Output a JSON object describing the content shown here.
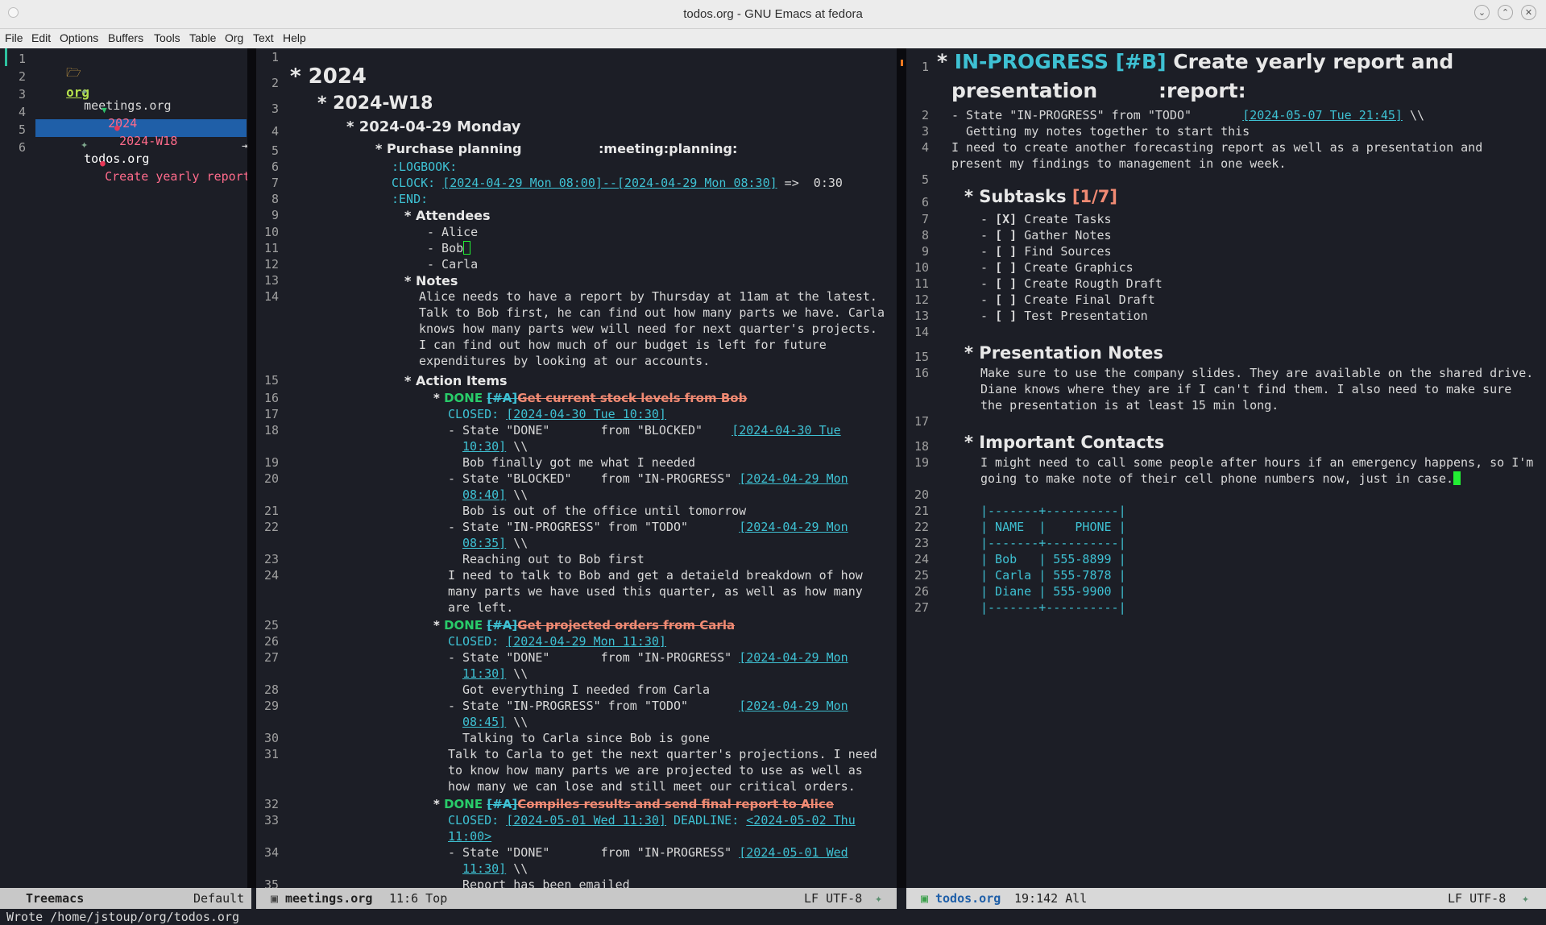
{
  "window": {
    "title": "todos.org - GNU Emacs at fedora",
    "buttons": [
      "minimize",
      "maximize",
      "close"
    ]
  },
  "menubar": [
    "File",
    "Edit",
    "Options",
    "Buffers",
    "Tools",
    "Table",
    "Org",
    "Text",
    "Help"
  ],
  "treemacs": {
    "items": [
      {
        "ln": "1",
        "label": "org",
        "icon": "folder-icon"
      },
      {
        "ln": "2",
        "label": "meetings.org",
        "icon": "org-unicorn-icon"
      },
      {
        "ln": "3",
        "label": "2024",
        "icon": "chevron-down-icon"
      },
      {
        "ln": "4",
        "label": "2024-W18",
        "icon": "bullet-icon"
      },
      {
        "ln": "5",
        "label": "todos.org",
        "icon": "org-unicorn-icon"
      },
      {
        "ln": "6",
        "label": "Create yearly report a",
        "icon": "bullet-icon"
      }
    ],
    "overflow_arrow": "⇥",
    "selection_color": "#1f5fa8"
  },
  "left": {
    "lines": {
      "l1": "1",
      "l2": "2",
      "l3": "3",
      "l4": "4",
      "l5": "5",
      "l6": "6",
      "l7": "7",
      "l8": "8",
      "l9": "9",
      "l10": "10",
      "l11": "11",
      "l12": "12",
      "l13": "13",
      "l14": "14",
      "l15": "15",
      "l16": "16",
      "l17": "17",
      "l18": "18",
      "l19": "19",
      "l20": "20",
      "l21": "21",
      "l22": "22",
      "l23": "23",
      "l24": "24",
      "l25": "25",
      "l26": "26",
      "l27": "27",
      "l28": "28",
      "l29": "29",
      "l30": "30",
      "l31": "31",
      "l32": "32",
      "l33": "33",
      "l34": "34",
      "l35": "35"
    },
    "h_2024": "2024",
    "h_w18": "2024-W18",
    "h_monday": "2024-04-29 Monday",
    "h_purchase": "Purchase planning",
    "h_purchase_tags": ":meeting:planning:",
    "logbook": ":LOGBOOK:",
    "clock_kw": "CLOCK:",
    "clock_range": "[2024-04-29 Mon 08:00]--[2024-04-29 Mon 08:30]",
    "clock_total": "=>  0:30",
    "end": ":END:",
    "h_attendees": "Attendees",
    "att1": "- Alice",
    "att2": "- Bob",
    "att3": "- Carla",
    "h_notes": "Notes",
    "notes": [
      "Alice needs to have a report by Thursday at 11am at the latest.",
      "Talk to Bob first, he can find out how many parts we have. Carla",
      "knows how many parts wew will need for next quarter's projects.",
      "I can find out how much of our budget is left for future",
      "expenditures by looking at our accounts."
    ],
    "h_action": "Action Items",
    "done": "DONE",
    "prio_a": "[#A]",
    "a1_title": "Get current stock levels from Bob",
    "a1_closed_kw": "CLOSED:",
    "a1_closed": "[2024-04-30 Tue 10:30]",
    "a1_s1_pre": "- State \"DONE\"       from \"BLOCKED\"    ",
    "a1_s1_ts1": "[2024-04-30 Tue",
    "a1_s1_ts2": "10:30]",
    "a1_s1_note": "Bob finally got me what I needed",
    "a1_s2_pre": "- State \"BLOCKED\"    from \"IN-PROGRESS\" ",
    "a1_s2_ts1": "[2024-04-29 Mon",
    "a1_s2_ts2": "08:40]",
    "a1_s2_note": "Bob is out of the office until tomorrow",
    "a1_s3_pre": "- State \"IN-PROGRESS\" from \"TODO\"       ",
    "a1_s3_ts1": "[2024-04-29 Mon",
    "a1_s3_ts2": "08:35]",
    "a1_s3_note": "Reaching out to Bob first",
    "backslash": " \\\\",
    "a1_body": [
      "I need to talk to Bob and get a detaield breakdown of how",
      "many parts we have used this quarter, as well as how many",
      "are left."
    ],
    "a2_title": "Get projected orders from Carla",
    "a2_closed": "[2024-04-29 Mon 11:30]",
    "a2_s1_pre": "- State \"DONE\"       from \"IN-PROGRESS\" ",
    "a2_s1_ts1": "[2024-04-29 Mon",
    "a2_s1_ts2": "11:30]",
    "a2_s1_note": "Got everything I needed from Carla",
    "a2_s2_pre": "- State \"IN-PROGRESS\" from \"TODO\"       ",
    "a2_s2_ts1": "[2024-04-29 Mon",
    "a2_s2_ts2": "08:45]",
    "a2_s2_note": "Talking to Carla since Bob is gone",
    "a2_body": [
      "Talk to Carla to get the next quarter's projections. I need",
      "to know how many parts we are projected to use as well as",
      "how many we can lose and still meet our critical orders."
    ],
    "a3_title": "Compiles results and send final report to Alice",
    "a3_closed": "[2024-05-01 Wed 11:30]",
    "a3_deadline_kw": "DEADLINE:",
    "a3_deadline1": "<2024-05-02 Thu",
    "a3_deadline2": "11:00>",
    "a3_s1_pre": "- State \"DONE\"       from \"IN-PROGRESS\" ",
    "a3_s1_ts1": "[2024-05-01 Wed",
    "a3_s1_ts2": "11:30]",
    "a3_s1_note": "Report has been emailed"
  },
  "right": {
    "lines": {
      "l1": "1",
      "l2": "2",
      "l3": "3",
      "l4": "4",
      "l5": "5",
      "l6": "6",
      "l7": "7",
      "l8": "8",
      "l9": "9",
      "l10": "10",
      "l11": "11",
      "l12": "12",
      "l13": "13",
      "l14": "14",
      "l15": "15",
      "l16": "16",
      "l17": "17",
      "l18": "18",
      "l19": "19",
      "l20": "20",
      "l21": "21",
      "l22": "22",
      "l23": "23",
      "l24": "24",
      "l25": "25",
      "l26": "26",
      "l27": "27"
    },
    "todo": "IN-PROGRESS",
    "prio_b": "[#B]",
    "title1": "Create yearly report and",
    "title2": "presentation",
    "tags": ":report:",
    "state_pre": "- State \"IN-PROGRESS\" from \"TODO\"       ",
    "state_ts": "[2024-05-07 Tue 21:45]",
    "state_bs": " \\\\",
    "state_note": "Getting my notes together to start this",
    "body1": "I need to create another forecasting report as well as a presentation and",
    "body2": "present my findings to management in one week.",
    "h_subtasks": "Subtasks",
    "subtasks_count": "[1/7]",
    "subtasks": [
      {
        "box": "[X]",
        "label": "Create Tasks"
      },
      {
        "box": "[ ]",
        "label": "Gather Notes"
      },
      {
        "box": "[ ]",
        "label": "Find Sources"
      },
      {
        "box": "[ ]",
        "label": "Create Graphics"
      },
      {
        "box": "[ ]",
        "label": "Create Rougth Draft"
      },
      {
        "box": "[ ]",
        "label": "Create Final Draft"
      },
      {
        "box": "[ ]",
        "label": "Test Presentation"
      }
    ],
    "h_presentation": "Presentation Notes",
    "pres": [
      "Make sure to use the company slides. They are available on the shared drive.",
      "Diane knows where they are if I can't find them. I also need to make sure",
      "the presentation is at least 15 min long."
    ],
    "h_contacts": "Important Contacts",
    "contacts_text1": "I might need to call some people after hours if an emergency happens, so I'm",
    "contacts_text2": "going to make note of their cell phone numbers now, just in case.",
    "table": [
      "|-------+----------|",
      "| NAME  |    PHONE |",
      "|-------+----------|",
      "| Bob   | 555-8899 |",
      "| Carla | 555-7878 |",
      "| Diane | 555-9900 |",
      "|-------+----------|"
    ]
  },
  "modeline": {
    "treemacs_name": "Treemacs",
    "treemacs_ws": "Default",
    "left_buffer": "meetings.org",
    "left_pos": "11:6 Top",
    "left_enc": "LF UTF-8",
    "right_buffer": "todos.org",
    "right_pos": "19:142 All",
    "right_enc": "LF UTF-8"
  },
  "echo": "Wrote /home/jstoup/org/todos.org"
}
